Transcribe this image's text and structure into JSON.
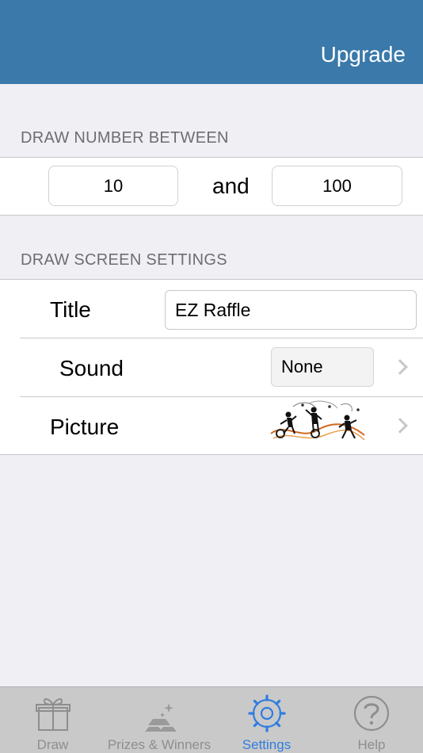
{
  "navbar": {
    "upgrade_label": "Upgrade"
  },
  "draw_range": {
    "header": "DRAW NUMBER BETWEEN",
    "min_value": "10",
    "and_label": "and",
    "max_value": "100"
  },
  "screen_settings": {
    "header": "DRAW SCREEN SETTINGS",
    "title_label": "Title",
    "title_value": "EZ Raffle",
    "sound_label": "Sound",
    "sound_value": "None",
    "picture_label": "Picture"
  },
  "tabs": [
    {
      "label": "Draw",
      "icon": "gift-icon",
      "active": false
    },
    {
      "label": "Prizes & Winners",
      "icon": "gold-bars-icon",
      "active": false
    },
    {
      "label": "Settings",
      "icon": "gear-icon",
      "active": true
    },
    {
      "label": "Help",
      "icon": "question-icon",
      "active": false
    }
  ],
  "colors": {
    "navbar": "#3a79aa",
    "accent": "#2f7de1",
    "inactive_tab": "#8e8e8e"
  }
}
